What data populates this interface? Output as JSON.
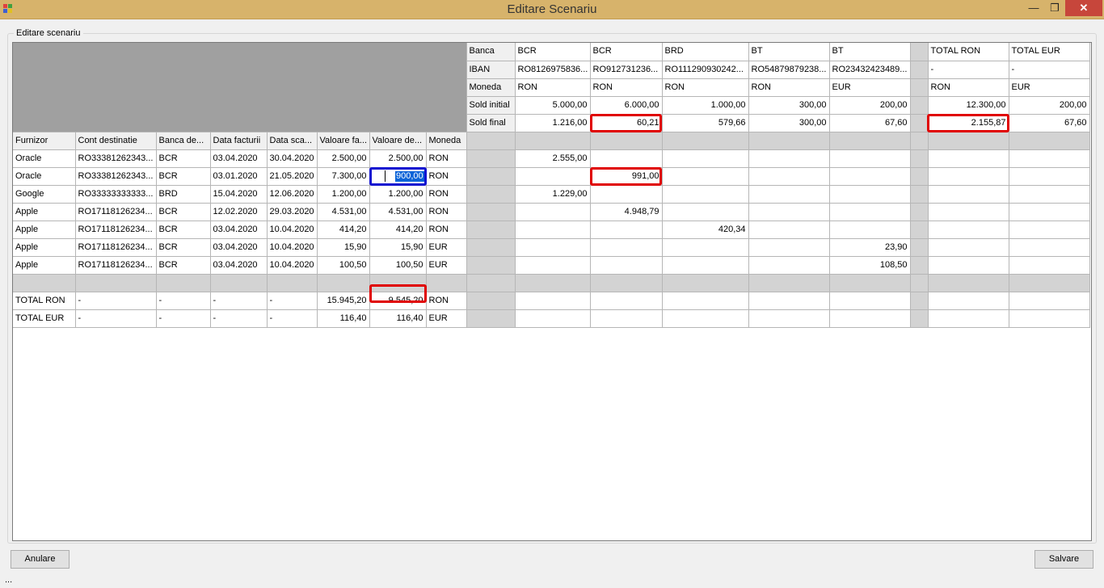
{
  "window": {
    "title": "Editare Scenariu",
    "min": "—",
    "max": "❐",
    "close": "✕"
  },
  "group": {
    "label": "Editare scenariu"
  },
  "left_headers": [
    "Furnizor",
    "Cont destinatie",
    "Banca de...",
    "Data facturii",
    "Data sca...",
    "Valoare fa...",
    "Valoare de...",
    "Moneda"
  ],
  "left_rows": [
    [
      "Oracle",
      "RO33381262343...",
      "BCR",
      "03.04.2020",
      "30.04.2020",
      "2.500,00",
      "2.500,00",
      "RON"
    ],
    [
      "Oracle",
      "RO33381262343...",
      "BCR",
      "03.01.2020",
      "21.05.2020",
      "7.300,00",
      "",
      "RON"
    ],
    [
      "Google",
      "RO33333333333...",
      "BRD",
      "15.04.2020",
      "12.06.2020",
      "1.200,00",
      "1.200,00",
      "RON"
    ],
    [
      "Apple",
      "RO17118126234...",
      "BCR",
      "12.02.2020",
      "29.03.2020",
      "4.531,00",
      "4.531,00",
      "RON"
    ],
    [
      "Apple",
      "RO17118126234...",
      "BCR",
      "03.04.2020",
      "10.04.2020",
      "414,20",
      "414,20",
      "RON"
    ],
    [
      "Apple",
      "RO17118126234...",
      "BCR",
      "03.04.2020",
      "10.04.2020",
      "15,90",
      "15,90",
      "EUR"
    ],
    [
      "Apple",
      "RO17118126234...",
      "BCR",
      "03.04.2020",
      "10.04.2020",
      "100,50",
      "100,50",
      "EUR"
    ],
    [
      "",
      "",
      "",
      "",
      "",
      "",
      "",
      ""
    ],
    [
      "TOTAL RON",
      "-",
      "-",
      "-",
      "-",
      "15.945,20",
      "9.545,20",
      "RON"
    ],
    [
      "TOTAL EUR",
      "-",
      "-",
      "-",
      "-",
      "116,40",
      "116,40",
      "EUR"
    ]
  ],
  "editing_value": "900,00",
  "summary_labels": [
    "Banca",
    "IBAN",
    "Moneda",
    "Sold initial",
    "Sold final"
  ],
  "summary_cols": [
    [
      "BCR",
      "RO8126975836...",
      "RON",
      "5.000,00",
      "1.216,00"
    ],
    [
      "BCR",
      "RO912731236...",
      "RON",
      "6.000,00",
      "60,21"
    ],
    [
      "BRD",
      "RO111290930242...",
      "RON",
      "1.000,00",
      "579,66"
    ],
    [
      "BT",
      "RO54879879238...",
      "RON",
      "300,00",
      "300,00"
    ],
    [
      "BT",
      "RO23432423489...",
      "EUR",
      "200,00",
      "67,60"
    ],
    [
      "",
      "",
      "",
      "",
      ""
    ],
    [
      "TOTAL RON",
      "-",
      "RON",
      "12.300,00",
      "2.155,87"
    ],
    [
      "TOTAL EUR",
      "-",
      "EUR",
      "200,00",
      "67,60"
    ]
  ],
  "alloc_rows": [
    [
      "2.555,00",
      "",
      "",
      "",
      "",
      "",
      "",
      ""
    ],
    [
      "",
      "991,00",
      "",
      "",
      "",
      "",
      "",
      ""
    ],
    [
      "1.229,00",
      "",
      "",
      "",
      "",
      "",
      "",
      ""
    ],
    [
      "",
      "4.948,79",
      "",
      "",
      "",
      "",
      "",
      ""
    ],
    [
      "",
      "",
      "420,34",
      "",
      "",
      "",
      "",
      ""
    ],
    [
      "",
      "",
      "",
      "",
      "23,90",
      "",
      "",
      ""
    ],
    [
      "",
      "",
      "",
      "",
      "108,50",
      "",
      "",
      ""
    ],
    [
      "",
      "",
      "",
      "",
      "",
      "",
      "",
      ""
    ],
    [
      "",
      "",
      "",
      "",
      "",
      "",
      "",
      ""
    ],
    [
      "",
      "",
      "",
      "",
      "",
      "",
      "",
      ""
    ]
  ],
  "buttons": {
    "cancel": "Anulare",
    "save": "Salvare"
  },
  "status": {
    "text": "..."
  },
  "colors": {
    "titlebar": "#d7b36b",
    "highlight_red": "#e00000",
    "highlight_blue": "#1010d0",
    "selection": "#0a64d8"
  }
}
